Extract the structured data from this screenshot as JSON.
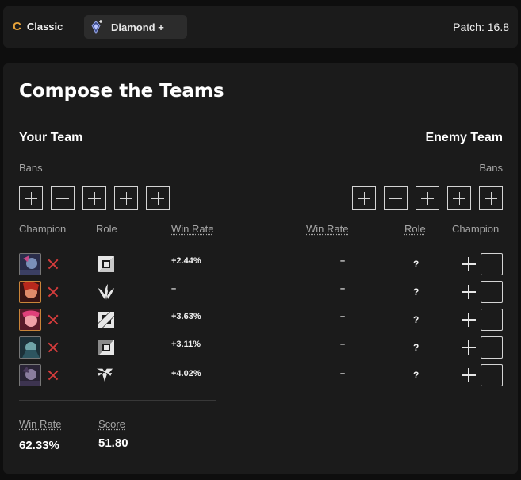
{
  "topbar": {
    "mode_icon": "C",
    "mode_label": "Classic",
    "rank_icon": "diamond-rank-icon",
    "rank_label": "Diamond +",
    "patch": "Patch: 16.8"
  },
  "panel": {
    "title": "Compose the Teams",
    "your_team": "Your Team",
    "enemy_team": "Enemy Team",
    "bans_label": "Bans",
    "columns": {
      "champion": "Champion",
      "role": "Role",
      "win_rate": "Win Rate"
    },
    "ally_picks": [
      {
        "champion": "ally-champion-1",
        "role": "top",
        "win_rate": "+2.44%"
      },
      {
        "champion": "ally-champion-2",
        "role": "jungle",
        "win_rate": "–"
      },
      {
        "champion": "ally-champion-3",
        "role": "mid",
        "win_rate": "+3.63%"
      },
      {
        "champion": "ally-champion-4",
        "role": "bottom",
        "win_rate": "+3.11%"
      },
      {
        "champion": "ally-champion-5",
        "role": "support",
        "win_rate": "+4.02%"
      }
    ],
    "enemy_picks": [
      {
        "win_rate": "–",
        "role": "?"
      },
      {
        "win_rate": "–",
        "role": "?"
      },
      {
        "win_rate": "–",
        "role": "?"
      },
      {
        "win_rate": "–",
        "role": "?"
      },
      {
        "win_rate": "–",
        "role": "?"
      }
    ],
    "summary": {
      "win_rate_label": "Win Rate",
      "win_rate_value": "62.33%",
      "score_label": "Score",
      "score_value": "51.80"
    }
  },
  "colors": {
    "background": "#0e0e0e",
    "panel": "#1b1b1b",
    "accent": "#e8a33a",
    "remove": "#d43c3c"
  }
}
